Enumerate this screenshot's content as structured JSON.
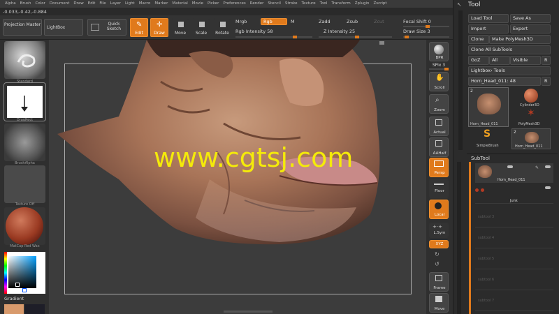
{
  "menu": [
    "Alpha",
    "Brush",
    "Color",
    "Document",
    "Draw",
    "Edit",
    "File",
    "Layer",
    "Light",
    "Macro",
    "Marker",
    "Material",
    "Movie",
    "Picker",
    "Preferences",
    "Render",
    "Stencil",
    "Stroke",
    "Texture",
    "Tool",
    "Transform",
    "Zplugin",
    "Zscript"
  ],
  "coords": "-0.033,-0.42,-0.884",
  "shelf": {
    "projection_master": "Projection Master",
    "lightbox": "LightBox",
    "quick_sketch": "Quick Sketch",
    "edit": "Edit",
    "draw": "Draw",
    "move": "Move",
    "scale": "Scale",
    "rotate": "Rotate",
    "mrgb": "Mrgb",
    "rgb": "Rgb",
    "m": "M",
    "rgb_intensity": "Rgb Intensity 58",
    "zadd": "Zadd",
    "zsub": "Zsub",
    "zcut": "Zcut",
    "z_intensity": "Z Intensity 25",
    "focal_shift": "Focal Shift 0",
    "draw_size": "Draw Size 3"
  },
  "left": {
    "standard": "Standard",
    "dragrect": "DragRect",
    "brushalpha": "BrushAlpha",
    "texture_off": "Texture Off",
    "matcap": "MatCap Red Wax",
    "gradient": "Gradient"
  },
  "watermark": "www.cgtsj.com",
  "right": {
    "bpr": "BPR",
    "spix": "SPix 3",
    "scroll": "Scroll",
    "zoom": "Zoom",
    "actual": "Actual",
    "aahalf": "AAHalf",
    "persp": "Persp",
    "floor": "Floor",
    "local": "Local",
    "lsym": "L.Sym",
    "xyz": "XYZ",
    "frame": "Frame",
    "move": "Move"
  },
  "tool": {
    "title": "Tool",
    "load_tool": "Load Tool",
    "save_as": "Save As",
    "import": "Import",
    "export": "Export",
    "clone": "Clone",
    "make_polymesh": "Make PolyMesh3D",
    "clone_all": "Clone All SubTools",
    "goz": "GoZ",
    "all": "All",
    "visible": "Visible",
    "r": "R",
    "lightbox_tools": "Lightbox› Tools",
    "current_tool": "Horn_Head_011: 48",
    "r2": "R",
    "thumb_count_1": "2",
    "thumb_count_2": "2",
    "cylinder": "Cylinder3D",
    "polymesh": "PolyMesh3D",
    "horn_head_a": "Horn_Head_011",
    "simplebrush": "SimpleBrush",
    "horn_head_b": "Horn_Head_011"
  },
  "subtool": {
    "title": "SubTool",
    "items": [
      "Horn_Head_011",
      "Junk"
    ],
    "empty": [
      "subtool 3",
      "subtool 4",
      "subtool 5",
      "subtool 6",
      "subtool 7",
      "subtool 8"
    ]
  }
}
